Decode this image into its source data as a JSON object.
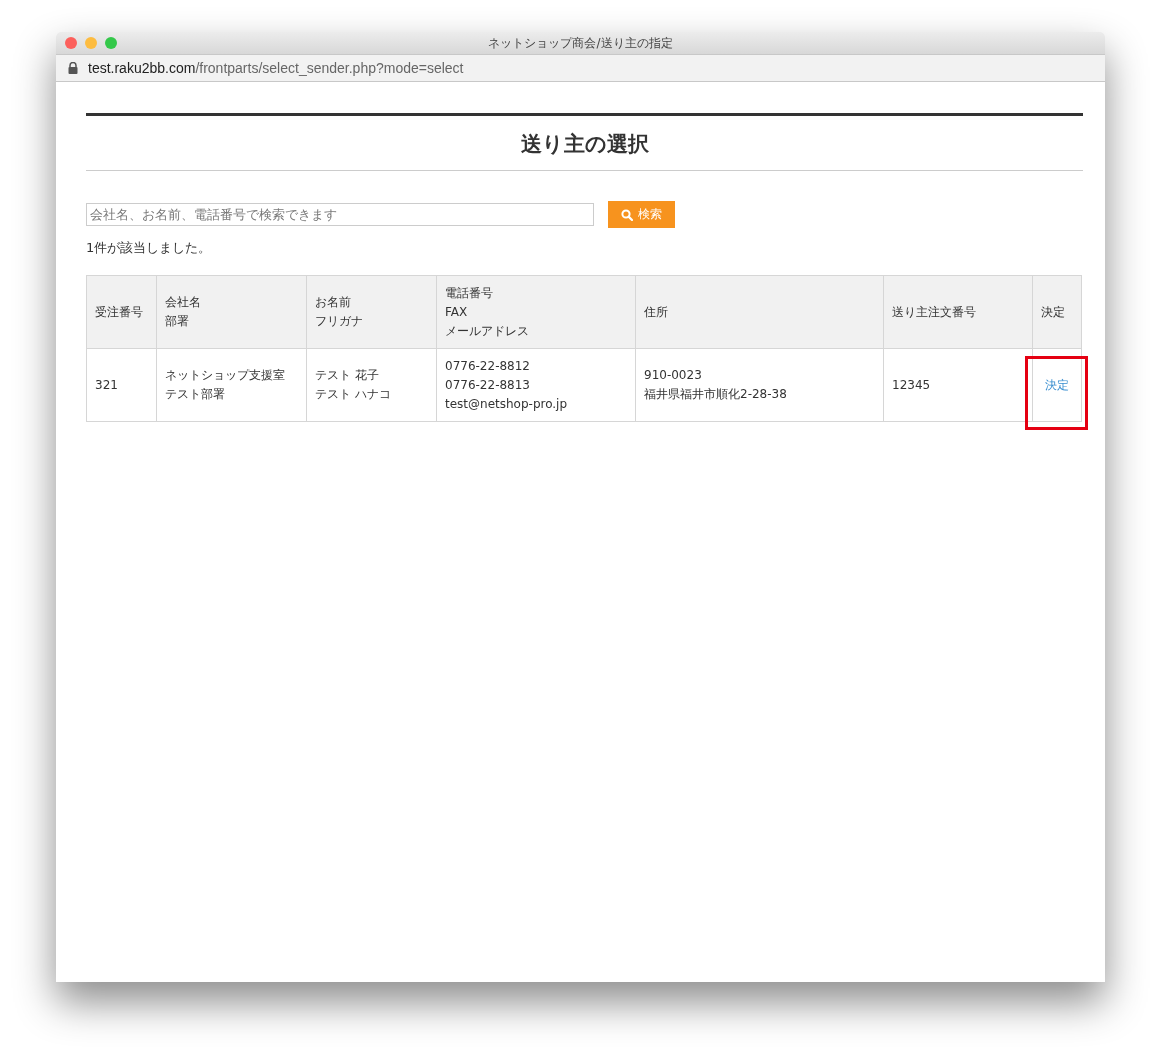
{
  "window": {
    "title": "ネットショップ商会/送り主の指定",
    "url_host": "test.raku2bb.com",
    "url_path": "/frontparts/select_sender.php?mode=select"
  },
  "page": {
    "heading": "送り主の選択"
  },
  "search": {
    "placeholder": "会社名、お名前、電話番号で検索できます",
    "button": "検索"
  },
  "result_count": "1件が該当しました。",
  "table": {
    "columns": [
      {
        "lines": [
          "受注番号"
        ]
      },
      {
        "lines": [
          "会社名",
          "部署"
        ]
      },
      {
        "lines": [
          "お名前",
          "フリガナ"
        ]
      },
      {
        "lines": [
          "電話番号",
          "FAX",
          "メールアドレス"
        ]
      },
      {
        "lines": [
          "住所"
        ]
      },
      {
        "lines": [
          "送り主注文番号"
        ]
      },
      {
        "lines": [
          "決定"
        ]
      }
    ],
    "rows": [
      {
        "cells": [
          {
            "lines": [
              "321"
            ]
          },
          {
            "lines": [
              "ネットショップ支援室",
              "テスト部署"
            ]
          },
          {
            "lines": [
              "テスト 花子",
              "テスト ハナコ"
            ]
          },
          {
            "lines": [
              "0776-22-8812",
              "0776-22-8813",
              "test@netshop-pro.jp"
            ]
          },
          {
            "lines": [
              "910-0023",
              "福井県福井市順化2-28-38"
            ]
          },
          {
            "lines": [
              "12345"
            ]
          }
        ],
        "action": "決定",
        "highlighted": true
      }
    ]
  }
}
